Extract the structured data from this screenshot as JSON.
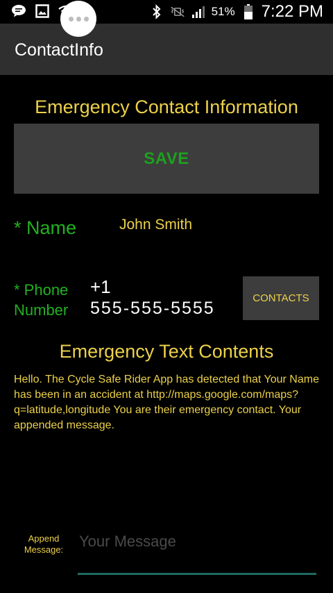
{
  "status_bar": {
    "battery_text": "51%",
    "time": "7:22 PM",
    "icons": [
      "chat-bubble-icon",
      "image-icon",
      "wifi-icon",
      "bluetooth-icon",
      "vibrate-mute-icon",
      "signal-icon",
      "battery-icon"
    ]
  },
  "action_bar": {
    "title": "ContactInfo"
  },
  "contact_section": {
    "heading": "Emergency Contact Information",
    "save_label": "SAVE",
    "name_label": "* Name",
    "name_value": "John Smith",
    "phone_label_line1": "* Phone",
    "phone_label_line2": "Number",
    "country_code": "+1",
    "phone_value": "555-555-5555",
    "contacts_label": "CONTACTS"
  },
  "text_section": {
    "heading": "Emergency Text Contents",
    "body": "Hello. The Cycle Safe Rider App has detected that Your Name has been in an accident at http://maps.google.com/maps?q=latitude,longitude You are their emergency contact. Your appended message."
  },
  "append": {
    "label_line1": "Append",
    "label_line2": "Message:",
    "placeholder": "Your Message",
    "value": ""
  },
  "colors": {
    "accent_yellow": "#ecd14a",
    "label_green": "#22b022",
    "save_green": "#1ea01e",
    "button_bg": "#3d3d3d",
    "action_bar_bg": "#2f2f2f",
    "underline_teal": "#1f6a63"
  }
}
